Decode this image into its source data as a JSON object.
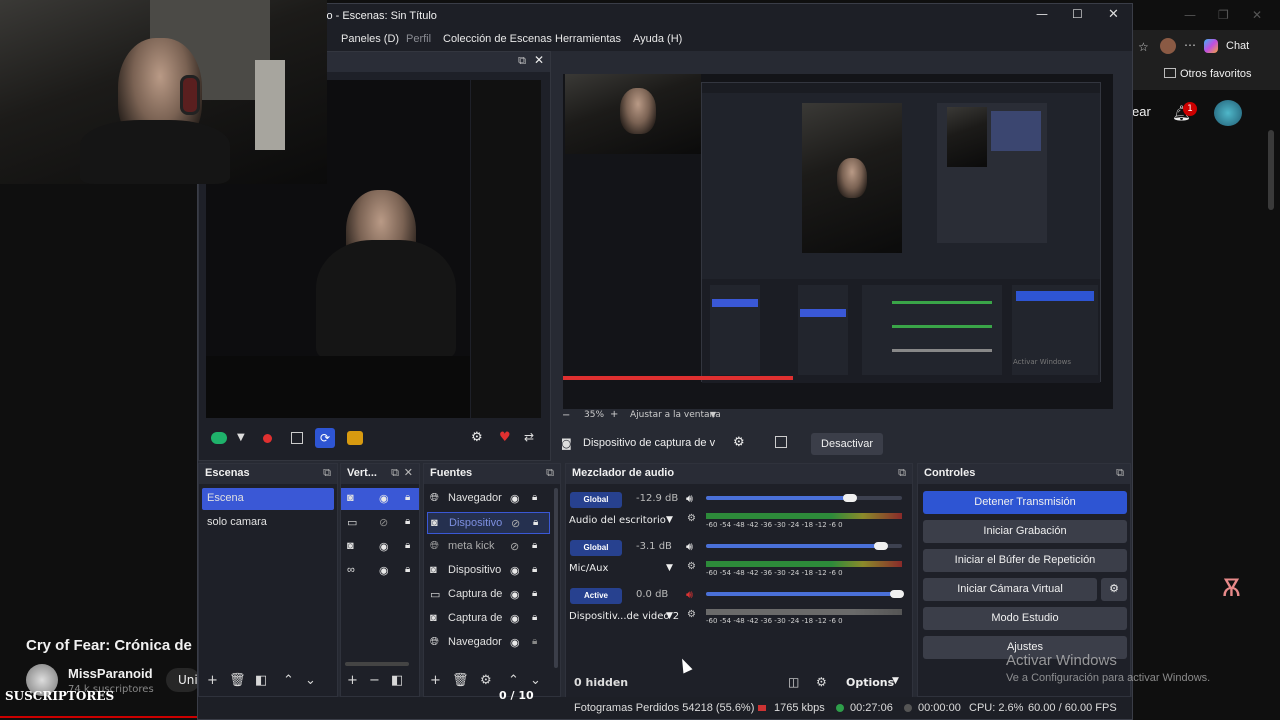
{
  "obs": {
    "title": "lo - Escenas: Sin Título",
    "menu": [
      "Paneles (D)",
      "Perfil",
      "Colección de Escenas",
      "Herramientas",
      "Ayuda (H)"
    ],
    "preview_zoom": "35%",
    "preview_fit": "Ajustar a la ventana",
    "source_toolbar": {
      "source_name": "Dispositivo de captura de v",
      "deactivate": "Desactivar"
    },
    "docks": {
      "scenes": {
        "title": "Escenas",
        "items": [
          "Escena",
          "solo camara"
        ]
      },
      "vert": {
        "title": "Vert..."
      },
      "sources": {
        "title": "Fuentes",
        "items": [
          {
            "label": "Navegador",
            "icon": "globe-icon"
          },
          {
            "label": "Dispositivo",
            "icon": "camera-icon"
          },
          {
            "label": "meta kick",
            "icon": "globe-icon"
          },
          {
            "label": "Dispositivo",
            "icon": "camera-icon"
          },
          {
            "label": "Captura de",
            "icon": "monitor-icon"
          },
          {
            "label": "Captura de",
            "icon": "camera-icon"
          },
          {
            "label": "Navegador",
            "icon": "globe-icon"
          }
        ]
      },
      "mixer": {
        "title": "Mezclador de audio",
        "channels": [
          {
            "pill": "Global",
            "db": "-12.9 dB",
            "name": "Audio del escritorio",
            "level": 0.76
          },
          {
            "pill": "Global",
            "db": "-3.1 dB",
            "name": "Mic/Aux",
            "level": 0.92
          },
          {
            "pill": "Active",
            "db": "0.0 dB",
            "name": "Dispositiv...de video 2",
            "level": 1.0
          }
        ],
        "ticks": "-60 -54 -48 -42 -36 -30 -24 -18 -12 -6 0",
        "hidden": "0 hidden",
        "options": "Options"
      },
      "controls": {
        "title": "Controles",
        "buttons": [
          "Detener Transmisión",
          "Iniciar Grabación",
          "Iniciar el Búfer de Repetición",
          "Iniciar Cámara Virtual",
          "Modo Estudio",
          "Ajustes"
        ]
      }
    },
    "status": {
      "dropped": "Fotogramas Perdidos 54218 (55.6%)",
      "bitrate": "1765 kbps",
      "stream_time": "00:27:06",
      "rec_time": "00:00:00",
      "cpu": "CPU: 2.6%",
      "fps": "60.00 / 60.00 FPS"
    }
  },
  "browser": {
    "chat": "Chat",
    "favorites": "Otros favoritos",
    "subscribe_partial": "ear",
    "notification_count": "1"
  },
  "youtube": {
    "video_title": "Cry of Fear: Crónica de u",
    "channel": "MissParanoid",
    "subscribers": "74 k suscriptores",
    "join": "Unir",
    "overlay_label": "SUSCRIPTORES",
    "counter": "0 / 10"
  },
  "windows_watermark": {
    "line1": "Activar Windows",
    "line2": "Ve a Configuración para activar Windows."
  },
  "colors": {
    "accent": "#2e55d3",
    "obs_bg": "#272a33",
    "dock_bg": "#1e2028",
    "live_red": "#e03030"
  }
}
